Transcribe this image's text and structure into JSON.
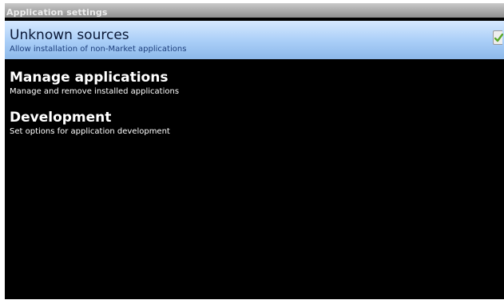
{
  "window": {
    "title": "Application settings"
  },
  "settings": [
    {
      "title": "Unknown sources",
      "summary": "Allow installation of non-Market applications",
      "checked": true
    },
    {
      "title": "Manage applications",
      "summary": "Manage and remove installed applications"
    },
    {
      "title": "Development",
      "summary": "Set options for application development"
    }
  ],
  "icons": {
    "checkbox_icon": "check-icon"
  },
  "colors": {
    "selected_row": "#a8cdf7",
    "background": "#000000",
    "check": "#5aa82a"
  }
}
